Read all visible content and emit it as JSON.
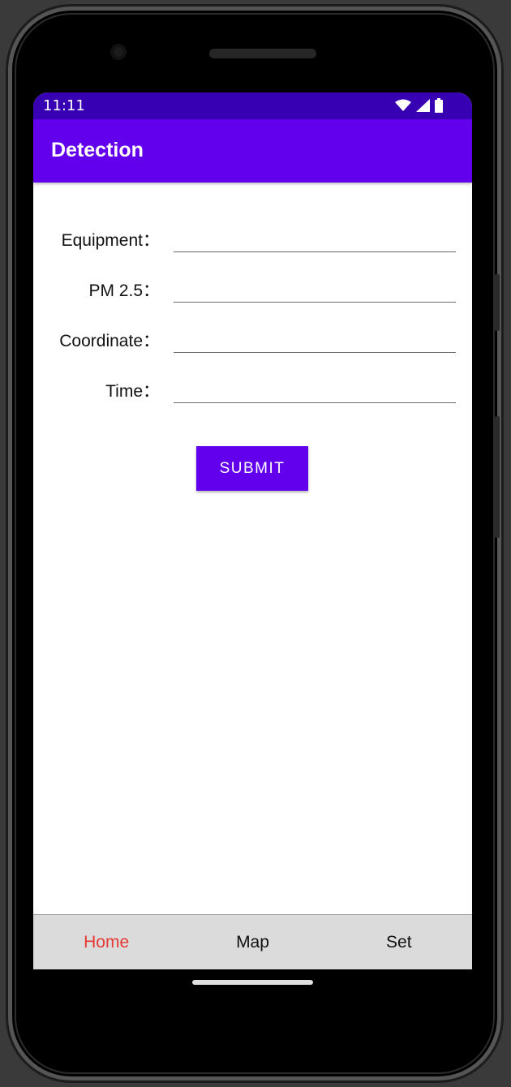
{
  "status_bar": {
    "time": "11:11"
  },
  "app_bar": {
    "title": "Detection"
  },
  "form": {
    "fields": [
      {
        "label": "Equipment：",
        "value": ""
      },
      {
        "label": "PM 2.5：",
        "value": ""
      },
      {
        "label": "Coordinate：",
        "value": ""
      },
      {
        "label": "Time：",
        "value": ""
      }
    ],
    "submit_label": "SUBMIT"
  },
  "bottom_nav": {
    "items": [
      {
        "label": "Home",
        "active": true
      },
      {
        "label": "Map",
        "active": false
      },
      {
        "label": "Set",
        "active": false
      }
    ]
  },
  "colors": {
    "status_bar": "#3700b3",
    "primary": "#6200ee",
    "active_nav": "#e53935",
    "nav_background": "#dcdbdc"
  },
  "icons": [
    "wifi-icon",
    "cellular-signal-icon",
    "battery-icon"
  ]
}
